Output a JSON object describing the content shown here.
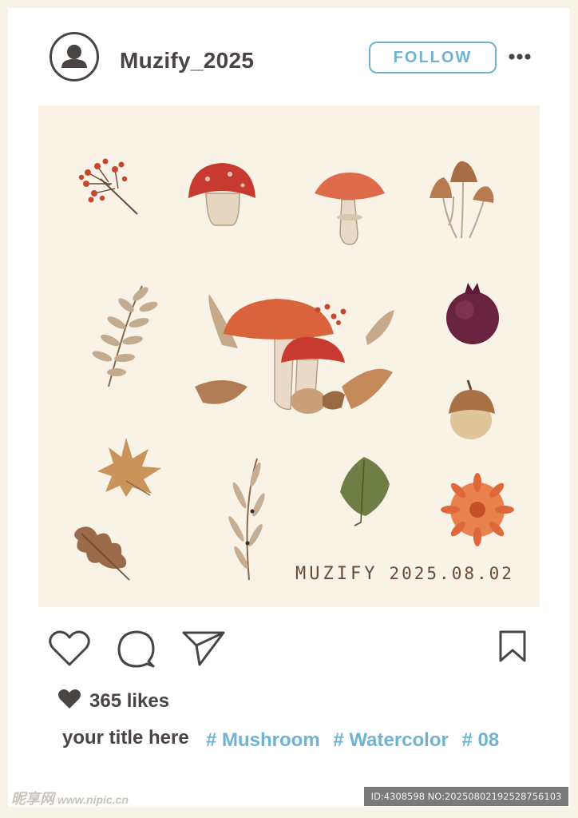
{
  "post": {
    "username": "Muzify_2025",
    "follow_label": "FOLLOW",
    "image_stamp_brand": "MUZIFY",
    "image_stamp_date": "2025.08.02",
    "likes": "365 likes",
    "caption": "your title here",
    "hashtags": [
      "# Mushroom",
      "# Watercolor",
      "# 08"
    ]
  },
  "icons": {
    "avatar": "user-avatar-icon",
    "more": "more-options-icon",
    "like": "heart-outline-icon",
    "comment": "comment-bubble-icon",
    "share": "paper-plane-icon",
    "save": "bookmark-icon",
    "likes": "heart-filled-icon"
  },
  "colors": {
    "text": "#4a4442",
    "accent": "#6fb3cf",
    "image_bg": "#f8f3e6",
    "page_bg": "#f7f3e6"
  },
  "watermark": {
    "site": "昵享网",
    "url": "www.nipic.cn",
    "id_text": "ID:4308598 NO:20250802192528756103"
  }
}
